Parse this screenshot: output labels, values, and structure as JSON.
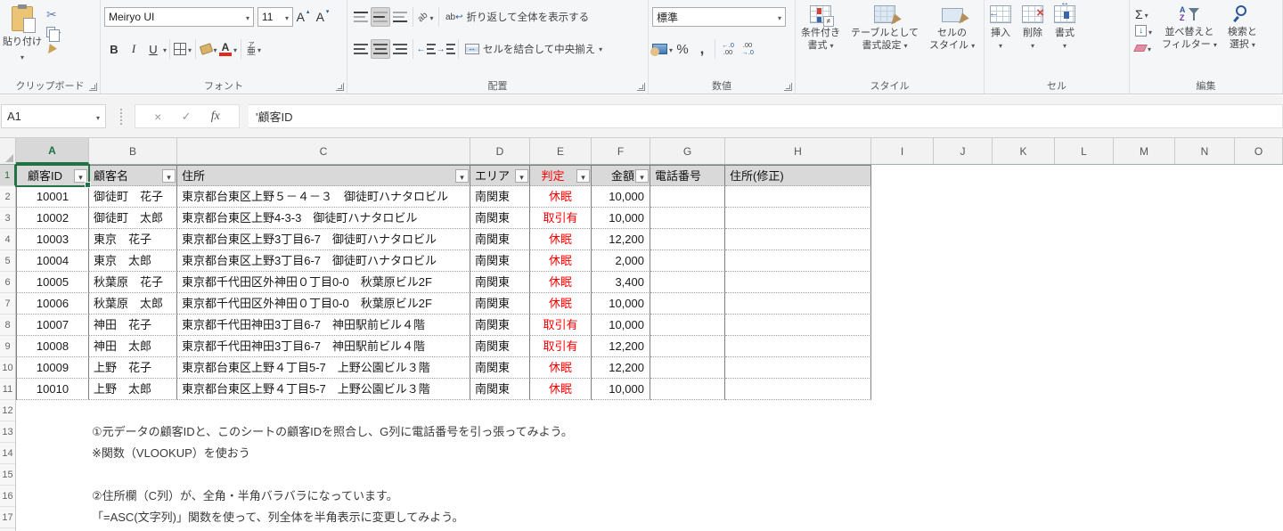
{
  "ribbon": {
    "clipboard": {
      "paste_label": "貼り付け",
      "group_label": "クリップボード"
    },
    "font": {
      "name": "Meiryo UI",
      "size": "11",
      "bold": "B",
      "italic": "I",
      "underline": "U",
      "grow": "A",
      "shrink": "A",
      "ruby_top": "ア",
      "ruby_bottom": "亜",
      "group_label": "フォント"
    },
    "alignment": {
      "orientation": "ab",
      "wrap_ab": "ab",
      "wrap_label": "折り返して全体を表示する",
      "merge_label": "セルを結合して中央揃え",
      "group_label": "配置"
    },
    "number": {
      "format": "標準",
      "percent": "%",
      "comma": ",",
      "inc_top": "←.0",
      "inc_bottom": ".00",
      "dec_top": ".00",
      "dec_bottom": "→.0",
      "group_label": "数値"
    },
    "styles": {
      "conditional_line1": "条件付き",
      "conditional_line2": "書式",
      "table_line1": "テーブルとして",
      "table_line2": "書式設定",
      "cellstyles_line1": "セルの",
      "cellstyles_line2": "スタイル",
      "group_label": "スタイル"
    },
    "cells": {
      "insert": "挿入",
      "delete": "削除",
      "format": "書式",
      "group_label": "セル"
    },
    "editing": {
      "sigma": "Σ",
      "sort_line1": "並べ替えと",
      "sort_line2": "フィルター",
      "find_line1": "検索と",
      "find_line2": "選択",
      "group_label": "編集"
    }
  },
  "formula_bar": {
    "name_box": "A1",
    "fx": "fx",
    "formula": "'顧客ID"
  },
  "sheet": {
    "column_letters": [
      "A",
      "B",
      "C",
      "D",
      "E",
      "F",
      "G",
      "H",
      "I",
      "J",
      "K",
      "L",
      "M",
      "N",
      "O"
    ],
    "row_numbers": [
      "1",
      "2",
      "3",
      "4",
      "5",
      "6",
      "7",
      "8",
      "9",
      "10",
      "11",
      "12",
      "13",
      "14",
      "15",
      "16",
      "17"
    ],
    "active": {
      "cell": "A1",
      "column": "A",
      "row": "1"
    },
    "table": {
      "headers": [
        {
          "label": "顧客ID",
          "filter": true,
          "align": "ac"
        },
        {
          "label": "顧客名",
          "filter": true,
          "align": "al"
        },
        {
          "label": "住所",
          "filter": true,
          "align": "al"
        },
        {
          "label": "エリア",
          "filter": true,
          "align": "al"
        },
        {
          "label": "判定",
          "filter": true,
          "align": "ac",
          "red": true
        },
        {
          "label": "金額",
          "filter": true,
          "align": "ar"
        },
        {
          "label": "電話番号",
          "filter": false,
          "align": "al"
        },
        {
          "label": "住所(修正)",
          "filter": false,
          "align": "al"
        }
      ],
      "rows": [
        {
          "id": "10001",
          "name": "御徒町　花子",
          "address": "東京都台東区上野５－４－３　御徒町ハナタロビル",
          "area": "南関東",
          "status": "休眠",
          "amount": "10,000",
          "phone": "",
          "fixed": ""
        },
        {
          "id": "10002",
          "name": "御徒町　太郎",
          "address": "東京都台東区上野4-3-3　御徒町ハナタロビル",
          "area": "南関東",
          "status": "取引有",
          "amount": "10,000",
          "phone": "",
          "fixed": ""
        },
        {
          "id": "10003",
          "name": "東京　花子",
          "address": "東京都台東区上野3丁目6-7　御徒町ハナタロビル",
          "area": "南関東",
          "status": "休眠",
          "amount": "12,200",
          "phone": "",
          "fixed": ""
        },
        {
          "id": "10004",
          "name": "東京　太郎",
          "address": "東京都台東区上野3丁目6-7　御徒町ハナタロビル",
          "area": "南関東",
          "status": "休眠",
          "amount": "2,000",
          "phone": "",
          "fixed": ""
        },
        {
          "id": "10005",
          "name": "秋葉原　花子",
          "address": "東京都千代田区外神田０丁目0-0　秋葉原ビル2F",
          "area": "南関東",
          "status": "休眠",
          "amount": "3,400",
          "phone": "",
          "fixed": ""
        },
        {
          "id": "10006",
          "name": "秋葉原　太郎",
          "address": "東京都千代田区外神田０丁目0-0　秋葉原ビル2F",
          "area": "南関東",
          "status": "休眠",
          "amount": "10,000",
          "phone": "",
          "fixed": ""
        },
        {
          "id": "10007",
          "name": "神田　花子",
          "address": "東京都千代田神田3丁目6-7　神田駅前ビル４階",
          "area": "南関東",
          "status": "取引有",
          "amount": "10,000",
          "phone": "",
          "fixed": ""
        },
        {
          "id": "10008",
          "name": "神田　太郎",
          "address": "東京都千代田神田3丁目6-7　神田駅前ビル４階",
          "area": "南関東",
          "status": "取引有",
          "amount": "12,200",
          "phone": "",
          "fixed": ""
        },
        {
          "id": "10009",
          "name": "上野　花子",
          "address": "東京都台東区上野４丁目5-7　上野公園ビル３階",
          "area": "南関東",
          "status": "休眠",
          "amount": "12,200",
          "phone": "",
          "fixed": ""
        },
        {
          "id": "10010",
          "name": "上野　太郎",
          "address": "東京都台東区上野４丁目5-7　上野公園ビル３階",
          "area": "南関東",
          "status": "休眠",
          "amount": "10,000",
          "phone": "",
          "fixed": ""
        }
      ]
    },
    "notes": [
      {
        "row": 13,
        "text": "①元データの顧客IDと、このシートの顧客IDを照合し、G列に電話番号を引っ張ってみよう。"
      },
      {
        "row": 14,
        "text": "※関数（VLOOKUP）を使おう"
      },
      {
        "row": 16,
        "text": "②住所欄（C列）が、全角・半角バラバラになっています。"
      },
      {
        "row": 17,
        "text": "「=ASC(文字列)」関数を使って、列全体を半角表示に変更してみよう。"
      }
    ],
    "colors": {
      "accent_green": "#217346",
      "status_red": "#FF0000",
      "header_fill": "#D9D9D9"
    }
  }
}
